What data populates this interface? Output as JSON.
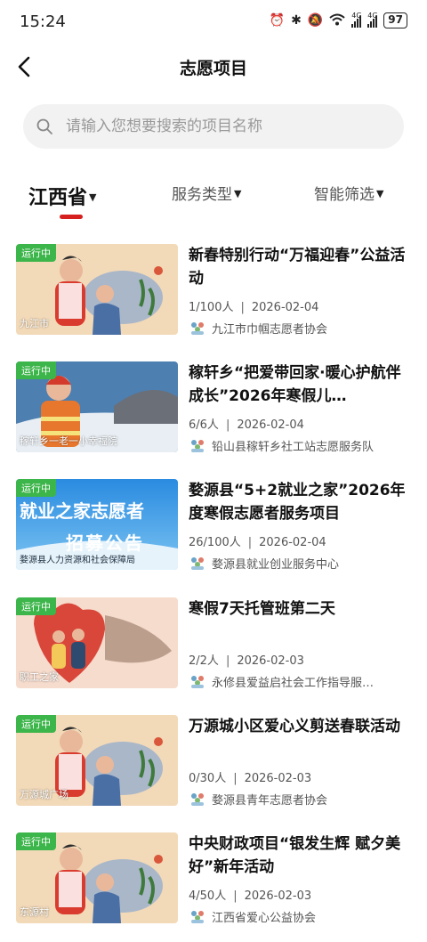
{
  "status": {
    "time": "15:24",
    "battery": "97",
    "icons": [
      "alarm-icon",
      "bluetooth-icon",
      "mute-icon",
      "wifi-icon",
      "signal-4g-icon",
      "signal-4g-icon"
    ],
    "net1": "4G",
    "net2": "4G"
  },
  "header": {
    "title": "志愿项目"
  },
  "search": {
    "placeholder": "请输入您想要搜索的项目名称"
  },
  "filters": [
    {
      "label": "江西省",
      "active": true
    },
    {
      "label": "服务类型",
      "active": false
    },
    {
      "label": "智能筛选",
      "active": false
    }
  ],
  "colors": {
    "accent": "#d6201f",
    "badge": "#3cb54a"
  },
  "items": [
    {
      "badge": "运行中",
      "location": "九江市",
      "title": "新春特别行动“万福迎春”公益活动",
      "people": "1/100人",
      "date": "2026-02-04",
      "org": "九江市巾帼志愿者协会"
    },
    {
      "badge": "运行中",
      "location": "稼轩乡一老一小幸福院",
      "title": "稼轩乡“把爱带回家·暖心护航伴成长”2026年寒假儿…",
      "people": "6/6人",
      "date": "2026-02-04",
      "org": "铅山县稼轩乡社工站志愿服务队"
    },
    {
      "badge": "运行中",
      "location": "婺源县人力资源和社会保障局",
      "title": "婺源县“5+2就业之家”2026年度寒假志愿者服务项目",
      "people": "26/100人",
      "date": "2026-02-04",
      "org": "婺源县就业创业服务中心",
      "poster_line1": "就业之家志愿者",
      "poster_line2": "招募公告"
    },
    {
      "badge": "运行中",
      "location": "职工之家",
      "title": "寒假7天托管班第二天",
      "people": "2/2人",
      "date": "2026-02-03",
      "org": "永修县爱益启社会工作指导服…"
    },
    {
      "badge": "运行中",
      "location": "万源城广场",
      "title": "万源城小区爱心义剪送春联活动",
      "people": "0/30人",
      "date": "2026-02-03",
      "org": "婺源县青年志愿者协会"
    },
    {
      "badge": "运行中",
      "location": "东源村",
      "title": "中央财政项目“银发生辉 赋夕美好”新年活动",
      "people": "4/50人",
      "date": "2026-02-03",
      "org": "江西省爱心公益协会"
    }
  ]
}
